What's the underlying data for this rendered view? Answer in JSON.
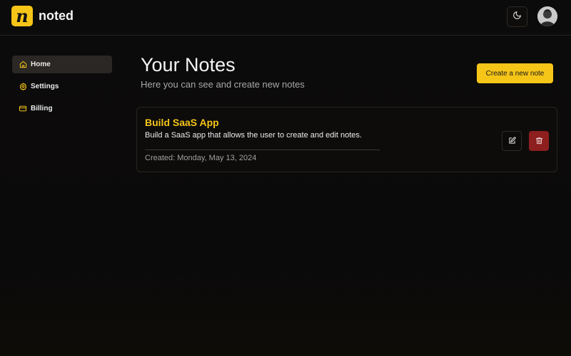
{
  "app": {
    "logo_letter": "n",
    "name": "noted"
  },
  "header": {
    "theme_icon": "moon-icon",
    "avatar": "user-avatar"
  },
  "sidebar": {
    "items": [
      {
        "label": "Home",
        "icon": "home-icon",
        "active": true
      },
      {
        "label": "Settings",
        "icon": "gear-icon",
        "active": false
      },
      {
        "label": "Billing",
        "icon": "credit-card-icon",
        "active": false
      }
    ]
  },
  "main": {
    "title": "Your Notes",
    "subtitle": "Here you can see and create new notes",
    "create_label": "Create a new note",
    "notes": [
      {
        "title": "Build SaaS App",
        "description": "Build a SaaS app that allows the user to create and edit notes.",
        "created": "Created: Monday, May 13, 2024"
      }
    ]
  },
  "colors": {
    "accent": "#f5c518",
    "danger": "#8e1f1f",
    "background": "#0b0a0a"
  }
}
